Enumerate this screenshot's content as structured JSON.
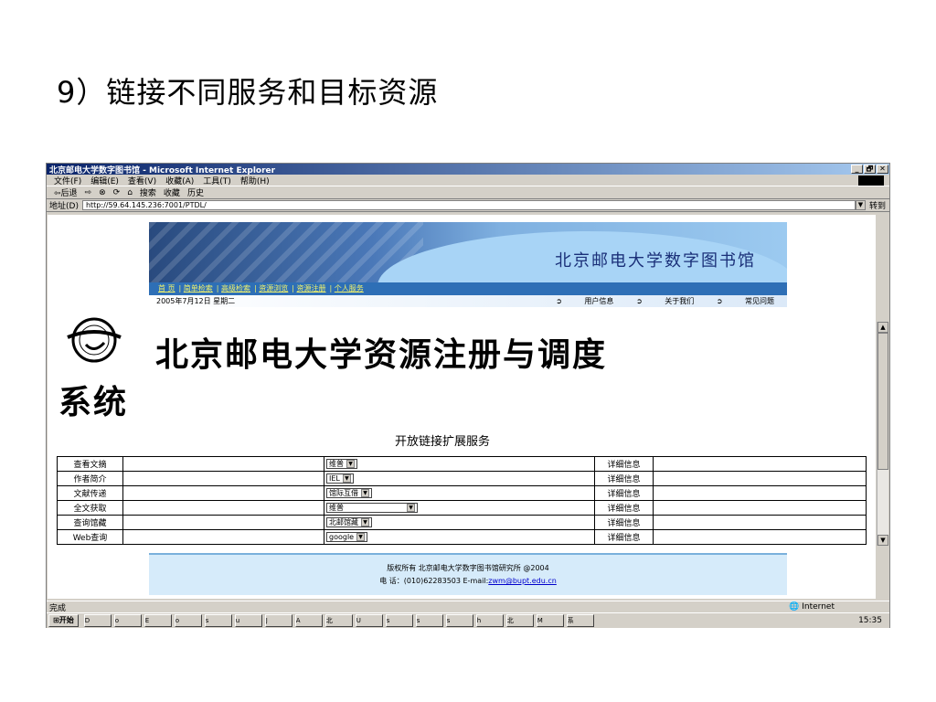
{
  "slide": {
    "title": "9）链接不同服务和目标资源"
  },
  "window": {
    "title": "北京邮电大学数字图书馆 - Microsoft Internet Explorer",
    "min": "_",
    "max": "🗗",
    "close": "✕"
  },
  "menu": [
    "文件(F)",
    "编辑(E)",
    "查看(V)",
    "收藏(A)",
    "工具(T)",
    "帮助(H)"
  ],
  "toolbar": [
    "⇦后退",
    "⇨",
    "⊗",
    "⟳",
    "⌂",
    "搜索",
    "收藏",
    "历史"
  ],
  "address": {
    "label": "地址(D)",
    "url": "http://59.64.145.236:7001/PTDL/",
    "go": "转到"
  },
  "page": {
    "banner_name": "北京邮电大学数字图书馆",
    "nav": [
      "首 页",
      "简单检索",
      "高级检索",
      "资源浏览",
      "资源注册",
      "个人服务"
    ],
    "date": "2005年7月12日 星期二",
    "top_links": [
      "用户信息",
      "关于我们",
      "常见问题"
    ],
    "big_title": "北京邮电大学资源注册与调度",
    "big_title2": "系统",
    "subhead": "开放链接扩展服务",
    "rows": [
      {
        "service": "查看文摘",
        "choice": "维普",
        "detail": "详细信息"
      },
      {
        "service": "作者简介",
        "choice": "IEL",
        "detail": "详细信息"
      },
      {
        "service": "文献传递",
        "choice": "馆际互借",
        "detail": "详细信息"
      },
      {
        "service": "全文获取",
        "choice": "维普",
        "detail": "详细信息"
      },
      {
        "service": "查询馆藏",
        "choice": "北邮馆藏",
        "detail": "详细信息"
      },
      {
        "service": "Web查询",
        "choice": "google",
        "detail": "详细信息"
      }
    ],
    "footer_line1": "版权所有 北京邮电大学数字图书馆研究所 @2004",
    "footer_line2_prefix": "电 话：(010)62283503 E-mail:",
    "footer_email": "zwm@bupt.edu.cn"
  },
  "status": {
    "left": "完成",
    "zone": "Internet"
  },
  "taskbar": {
    "start": "开始",
    "buttons": [
      "D",
      "o",
      "E",
      "o",
      "s",
      "u",
      "J",
      "A",
      "北",
      "U",
      "s",
      "s",
      "s",
      "h",
      "北",
      "M",
      "系"
    ],
    "clock": "15:35"
  }
}
